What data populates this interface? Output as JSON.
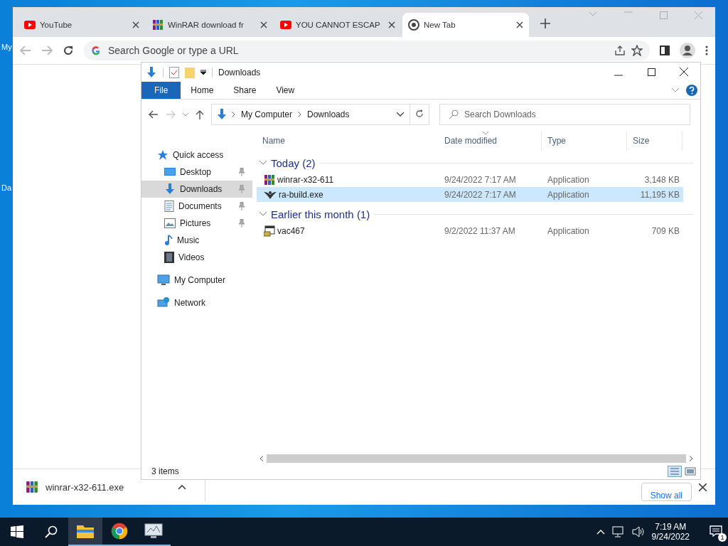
{
  "desktop": {
    "icon_labels": [
      "My",
      "Da"
    ]
  },
  "browser": {
    "tabs": [
      {
        "title": "YouTube",
        "kind": "youtube",
        "selected": false
      },
      {
        "title": "WinRAR download fr",
        "kind": "winrar",
        "selected": false
      },
      {
        "title": "YOU CANNOT ESCAP",
        "kind": "youtube",
        "selected": false
      },
      {
        "title": "New Tab",
        "kind": "chrome",
        "selected": true
      }
    ],
    "omnibox": {
      "placeholder": "Search Google or type a URL"
    },
    "download_bar": {
      "file": "winrar-x32-611.exe",
      "show_all": "Show all"
    }
  },
  "explorer": {
    "title": "Downloads",
    "ribbon_tabs": [
      {
        "label": "File",
        "selected": true
      },
      {
        "label": "Home",
        "selected": false
      },
      {
        "label": "Share",
        "selected": false
      },
      {
        "label": "View",
        "selected": false
      }
    ],
    "breadcrumb": [
      "My Computer",
      "Downloads"
    ],
    "search": {
      "placeholder": "Search Downloads"
    },
    "nav": [
      {
        "label": "Quick access",
        "kind": "star",
        "children": [
          {
            "label": "Desktop",
            "kind": "desktop",
            "pinned": true,
            "selected": false
          },
          {
            "label": "Downloads",
            "kind": "downloads",
            "pinned": true,
            "selected": true
          },
          {
            "label": "Documents",
            "kind": "documents",
            "pinned": true,
            "selected": false
          },
          {
            "label": "Pictures",
            "kind": "pictures",
            "pinned": true,
            "selected": false
          },
          {
            "label": "Music",
            "kind": "music",
            "pinned": false,
            "selected": false
          },
          {
            "label": "Videos",
            "kind": "videos",
            "pinned": false,
            "selected": false
          }
        ]
      },
      {
        "label": "My Computer",
        "kind": "computer"
      },
      {
        "label": "Network",
        "kind": "network"
      }
    ],
    "columns": [
      "Name",
      "Date modified",
      "Type",
      "Size"
    ],
    "groups": [
      {
        "label": "Today (2)",
        "files": [
          {
            "name": "winrar-x32-611",
            "kind": "winrar",
            "date": "9/24/2022 7:17 AM",
            "type": "Application",
            "size": "3,148 KB",
            "selected": false
          },
          {
            "name": "ra-build.exe",
            "kind": "bird",
            "date": "9/24/2022 7:17 AM",
            "type": "Application",
            "size": "11,195 KB",
            "selected": true
          }
        ]
      },
      {
        "label": "Earlier this month (1)",
        "files": [
          {
            "name": "vac467",
            "kind": "setup",
            "date": "9/2/2022 11:37 AM",
            "type": "Application",
            "size": "709 KB",
            "selected": false
          }
        ]
      }
    ],
    "status": "3 items"
  },
  "taskbar": {
    "apps": [
      {
        "kind": "explorer",
        "selected": true
      },
      {
        "kind": "chrome",
        "selected": false
      },
      {
        "kind": "monitor",
        "selected": false
      }
    ],
    "time": "7:19 AM",
    "date": "9/24/2022",
    "notifications": "1"
  }
}
